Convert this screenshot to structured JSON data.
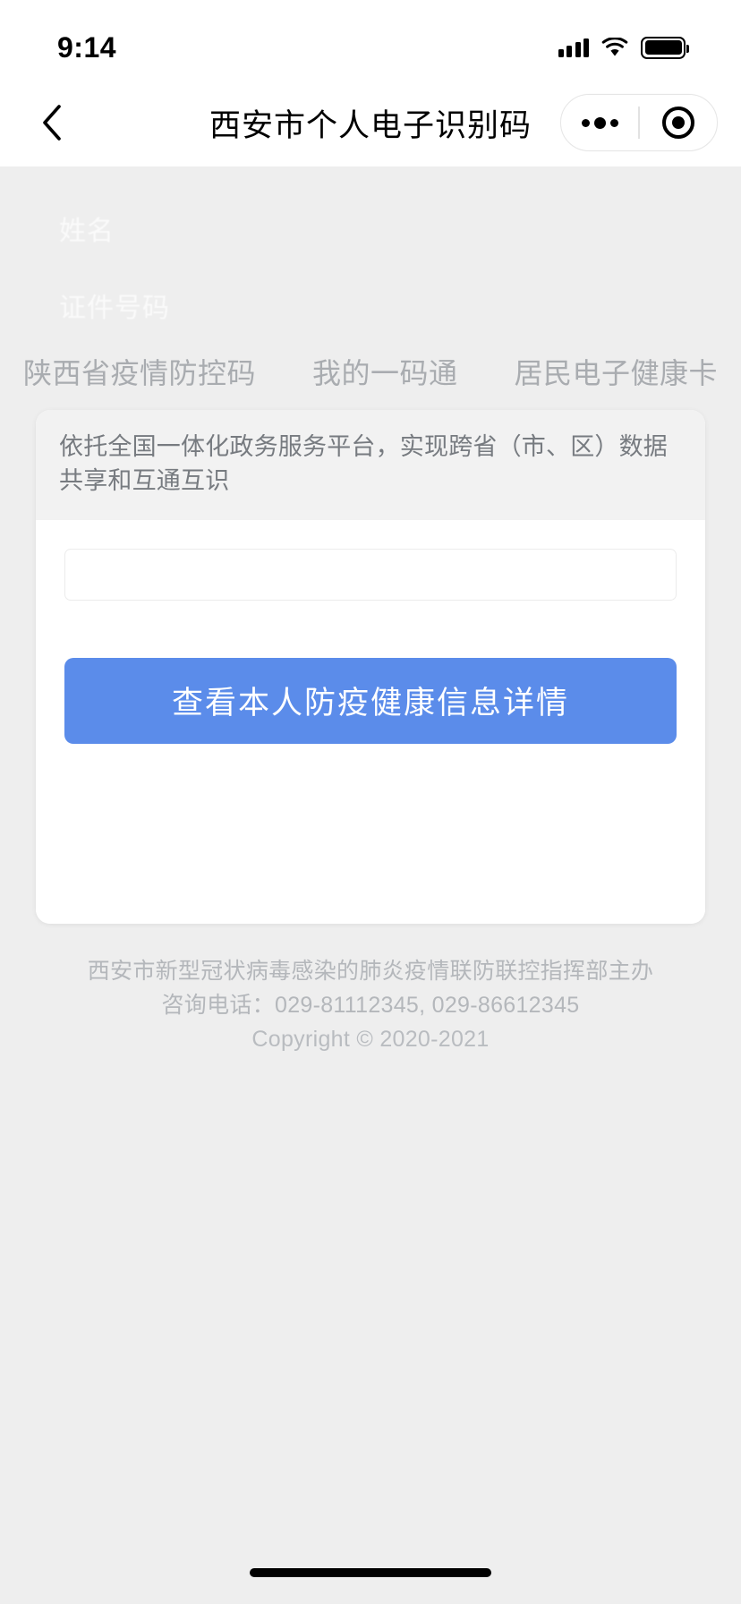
{
  "status_bar": {
    "time": "9:14",
    "signal_icon": "cellular-signal-icon",
    "wifi_icon": "wifi-icon",
    "battery_icon": "battery-full-icon"
  },
  "nav_bar": {
    "back_icon": "chevron-left-icon",
    "title": "西安市个人电子识别码",
    "more_icon": "more-dots-icon",
    "target_icon": "target-circle-icon"
  },
  "ghost_fields": {
    "name_label": "姓名",
    "id_label": "证件号码"
  },
  "tabs": [
    {
      "label": "陕西省疫情防控码",
      "active": false
    },
    {
      "label": "我的一码通",
      "active": false
    },
    {
      "label": "居民电子健康卡",
      "active": false
    }
  ],
  "card": {
    "banner_text": "依托全国一体化政务服务平台，实现跨省（市、区）数据共享和互通互识",
    "input_value": "",
    "input_placeholder": "",
    "button_label": "查看本人防疫健康信息详情"
  },
  "footer": {
    "line1": "西安市新型冠状病毒感染的肺炎疫情联防联控指挥部主办",
    "line2": "咨询电话：029-81112345, 029-86612345",
    "copyright": "Copyright © 2020-2021"
  },
  "colors": {
    "page_background": "#eeeeee",
    "primary_button": "#5b8cea",
    "tab_text": "#a9acb0",
    "banner_background": "#f2f2f2",
    "footer_text": "#b4b7bb"
  }
}
